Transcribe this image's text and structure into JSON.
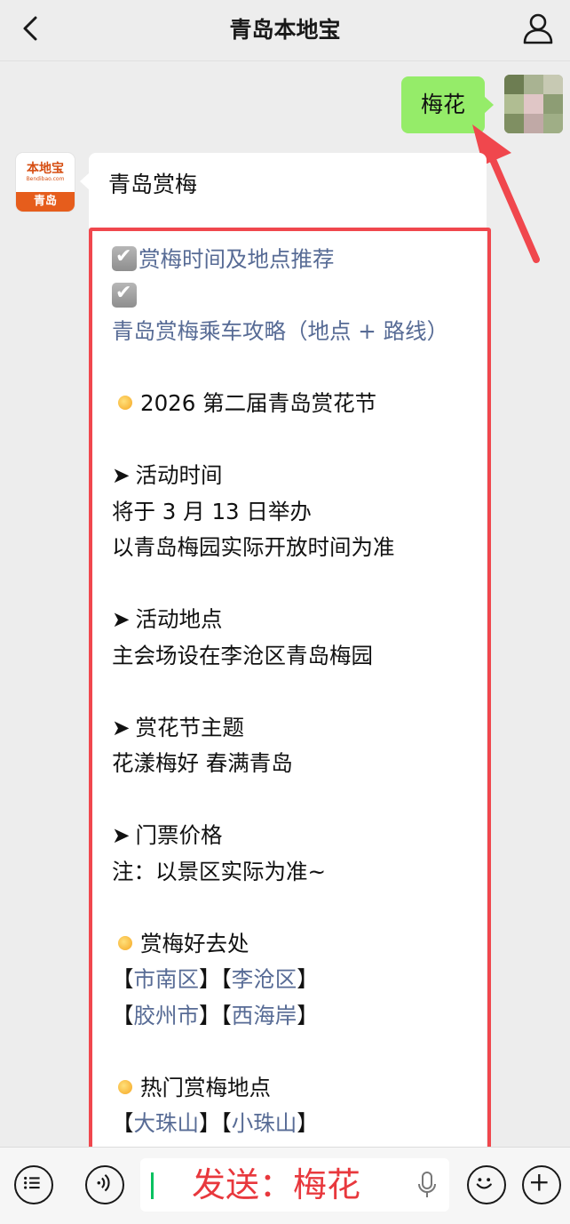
{
  "header": {
    "title": "青岛本地宝",
    "back_icon": "chevron-left-icon",
    "profile_icon": "person-icon"
  },
  "chat": {
    "user_message": "梅花",
    "bot": {
      "avatar_logo": "本地宝",
      "avatar_logo_sub": "Bendibao.com",
      "avatar_city": "青岛",
      "title": "青岛赏梅",
      "links_top": [
        "赏梅时间及地点推荐",
        "青岛赏梅乘车攻略（地点 + 路线）"
      ],
      "festival_heading": "2026 第二届青岛赏花节",
      "time_heading": "活动时间",
      "time_line1": "将于 3 月 13 日举办",
      "time_line2": "以青岛梅园实际开放时间为准",
      "place_heading": "活动地点",
      "place_line": "主会场设在李沧区青岛梅园",
      "theme_heading": "赏花节主题",
      "theme_line": "花漾梅好 春满青岛",
      "ticket_heading": "门票价格",
      "ticket_line": "注：以景区实际为准~",
      "goodplaces_heading": "赏梅好去处",
      "districts": [
        "市南区",
        "李沧区",
        "胶州市",
        "西海岸"
      ],
      "hot_heading": "热门赏梅地点",
      "hot_places": [
        "大珠山",
        "小珠山"
      ]
    }
  },
  "input": {
    "value": "发送：梅花"
  },
  "colors": {
    "user_bubble": "#95ec69",
    "link": "#576b95",
    "highlight": "#f0474d",
    "annotation_text": "#e8383d"
  }
}
